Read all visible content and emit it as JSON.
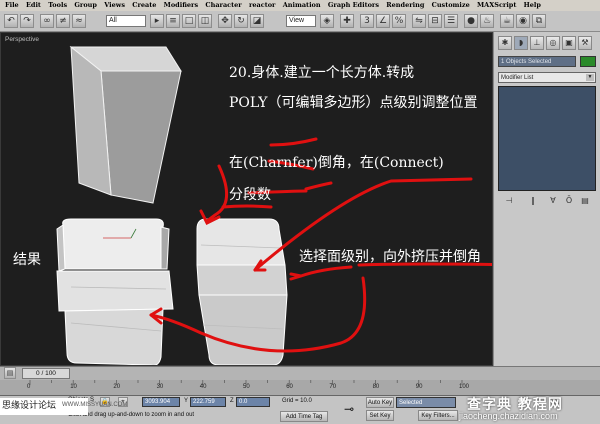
{
  "menu": [
    "File",
    "Edit",
    "Tools",
    "Group",
    "Views",
    "Create",
    "Modifiers",
    "Character",
    "reactor",
    "Animation",
    "Graph Editors",
    "Rendering",
    "Customize",
    "MAXScript",
    "Help"
  ],
  "toolbar": {
    "filter_value": "All",
    "view_value": "View"
  },
  "viewport": {
    "label": "Perspective",
    "annotations": {
      "line1": "20.身体.建立一个长方体.转成",
      "line2": "POLY（可编辑多边形）点级别调整位置",
      "line3": "在(Charnfer)倒角，在(Connect)",
      "line4": "分段数",
      "line5": "选择面级别，向外挤压并倒角",
      "result": "结果"
    },
    "stroke_color": "#e01010"
  },
  "command_panel": {
    "selection": "1 Objects Selected",
    "modifier_list": "Modifier List",
    "selection_color": "#2a8a2a"
  },
  "timeline": {
    "slider": "0 / 100",
    "ticks": [
      "0",
      "10",
      "20",
      "30",
      "40",
      "50",
      "60",
      "70",
      "80",
      "90",
      "100"
    ]
  },
  "status": {
    "objects": "Objects S",
    "x_value": "3093.904",
    "y_label": "Y",
    "y_value": "222.759",
    "z_label": "Z",
    "z_value": "0.0",
    "grid": "Grid = 10.0",
    "prompt": "Click and drag up-and-down to zoom in and out",
    "add_time_tag": "Add Time Tag",
    "auto_key": "Auto Key",
    "set_key": "Set Key",
    "key_filter": "Selected",
    "key_filters": "Key Filters..."
  },
  "watermarks": {
    "left": "思缘设计论坛",
    "left_url": "WWW.MISSYUAN.COM",
    "right_brand": "查字典 教程网",
    "right_url": "jiaocheng.chazidian.com"
  }
}
